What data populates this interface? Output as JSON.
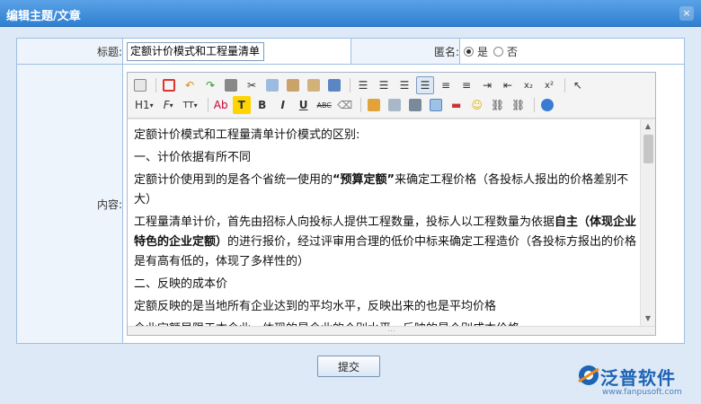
{
  "window": {
    "title": "编辑主题/文章",
    "close_glyph": "×"
  },
  "form": {
    "title_label": "标题:",
    "title_value": "定额计价模式和工程量清单",
    "anon_label": "匿名:",
    "anon_options": [
      "是",
      "否"
    ],
    "anon_selected": "是",
    "content_label": "内容:"
  },
  "toolbar": {
    "row1": [
      "source-icon",
      "fullscreen-icon",
      "undo-icon",
      "redo-icon",
      "print-icon",
      "cut-icon",
      "copy-icon",
      "paste-icon",
      "paste-text-icon",
      "paste-word-icon",
      "align-left-icon",
      "align-center-icon",
      "align-right-icon",
      "align-justify-icon",
      "ordered-list-icon",
      "unordered-list-icon",
      "indent-icon",
      "outdent-icon",
      "subscript-icon",
      "superscript-icon",
      "select-all-icon"
    ],
    "row2_labels": {
      "heading": "H1",
      "font": "F",
      "size": "TT",
      "forecolor": "Ab",
      "hilite": "T",
      "bold": "B",
      "italic": "I",
      "underline": "U",
      "strike": "ABC"
    }
  },
  "editor": {
    "paragraphs": [
      [
        {
          "t": "定额计价模式和工程量清单计价模式的区别:"
        }
      ],
      [
        {
          "t": "一、计价依据有所不同"
        }
      ],
      [
        {
          "t": "定额计价使用到的是各个省统一使用的"
        },
        {
          "t": "“预算定额”",
          "b": true
        },
        {
          "t": "来确定工程价格（各投标人报出的价格差别不大）"
        }
      ],
      [
        {
          "t": "工程量清单计价，首先由招标人向投标人提供工程数量，投标人以工程数量为依据"
        },
        {
          "t": "自主（体现企业特色的企业定额）",
          "b": true
        },
        {
          "t": "的进行报价，经过评审用合理的低价中标来确定工程造价（各投标方报出的价格是有高有低的，体现了多样性的）"
        }
      ],
      [
        {
          "t": "二、反映的成本价"
        }
      ],
      [
        {
          "t": "定额反映的是当地所有企业达到的平均水平，反映出来的也是平均价格"
        }
      ],
      [
        {
          "t": "企业定额局限于本企业，体现的是企业的个别水平，反映的是个别成本价格"
        }
      ]
    ]
  },
  "submit_label": "提交",
  "logo": {
    "brand": "泛普软件",
    "url": "www.fanpusoft.com"
  },
  "colors": {
    "titlebar": "#3b8ad8",
    "border": "#9fbfe0",
    "brand": "#1e64b4"
  }
}
